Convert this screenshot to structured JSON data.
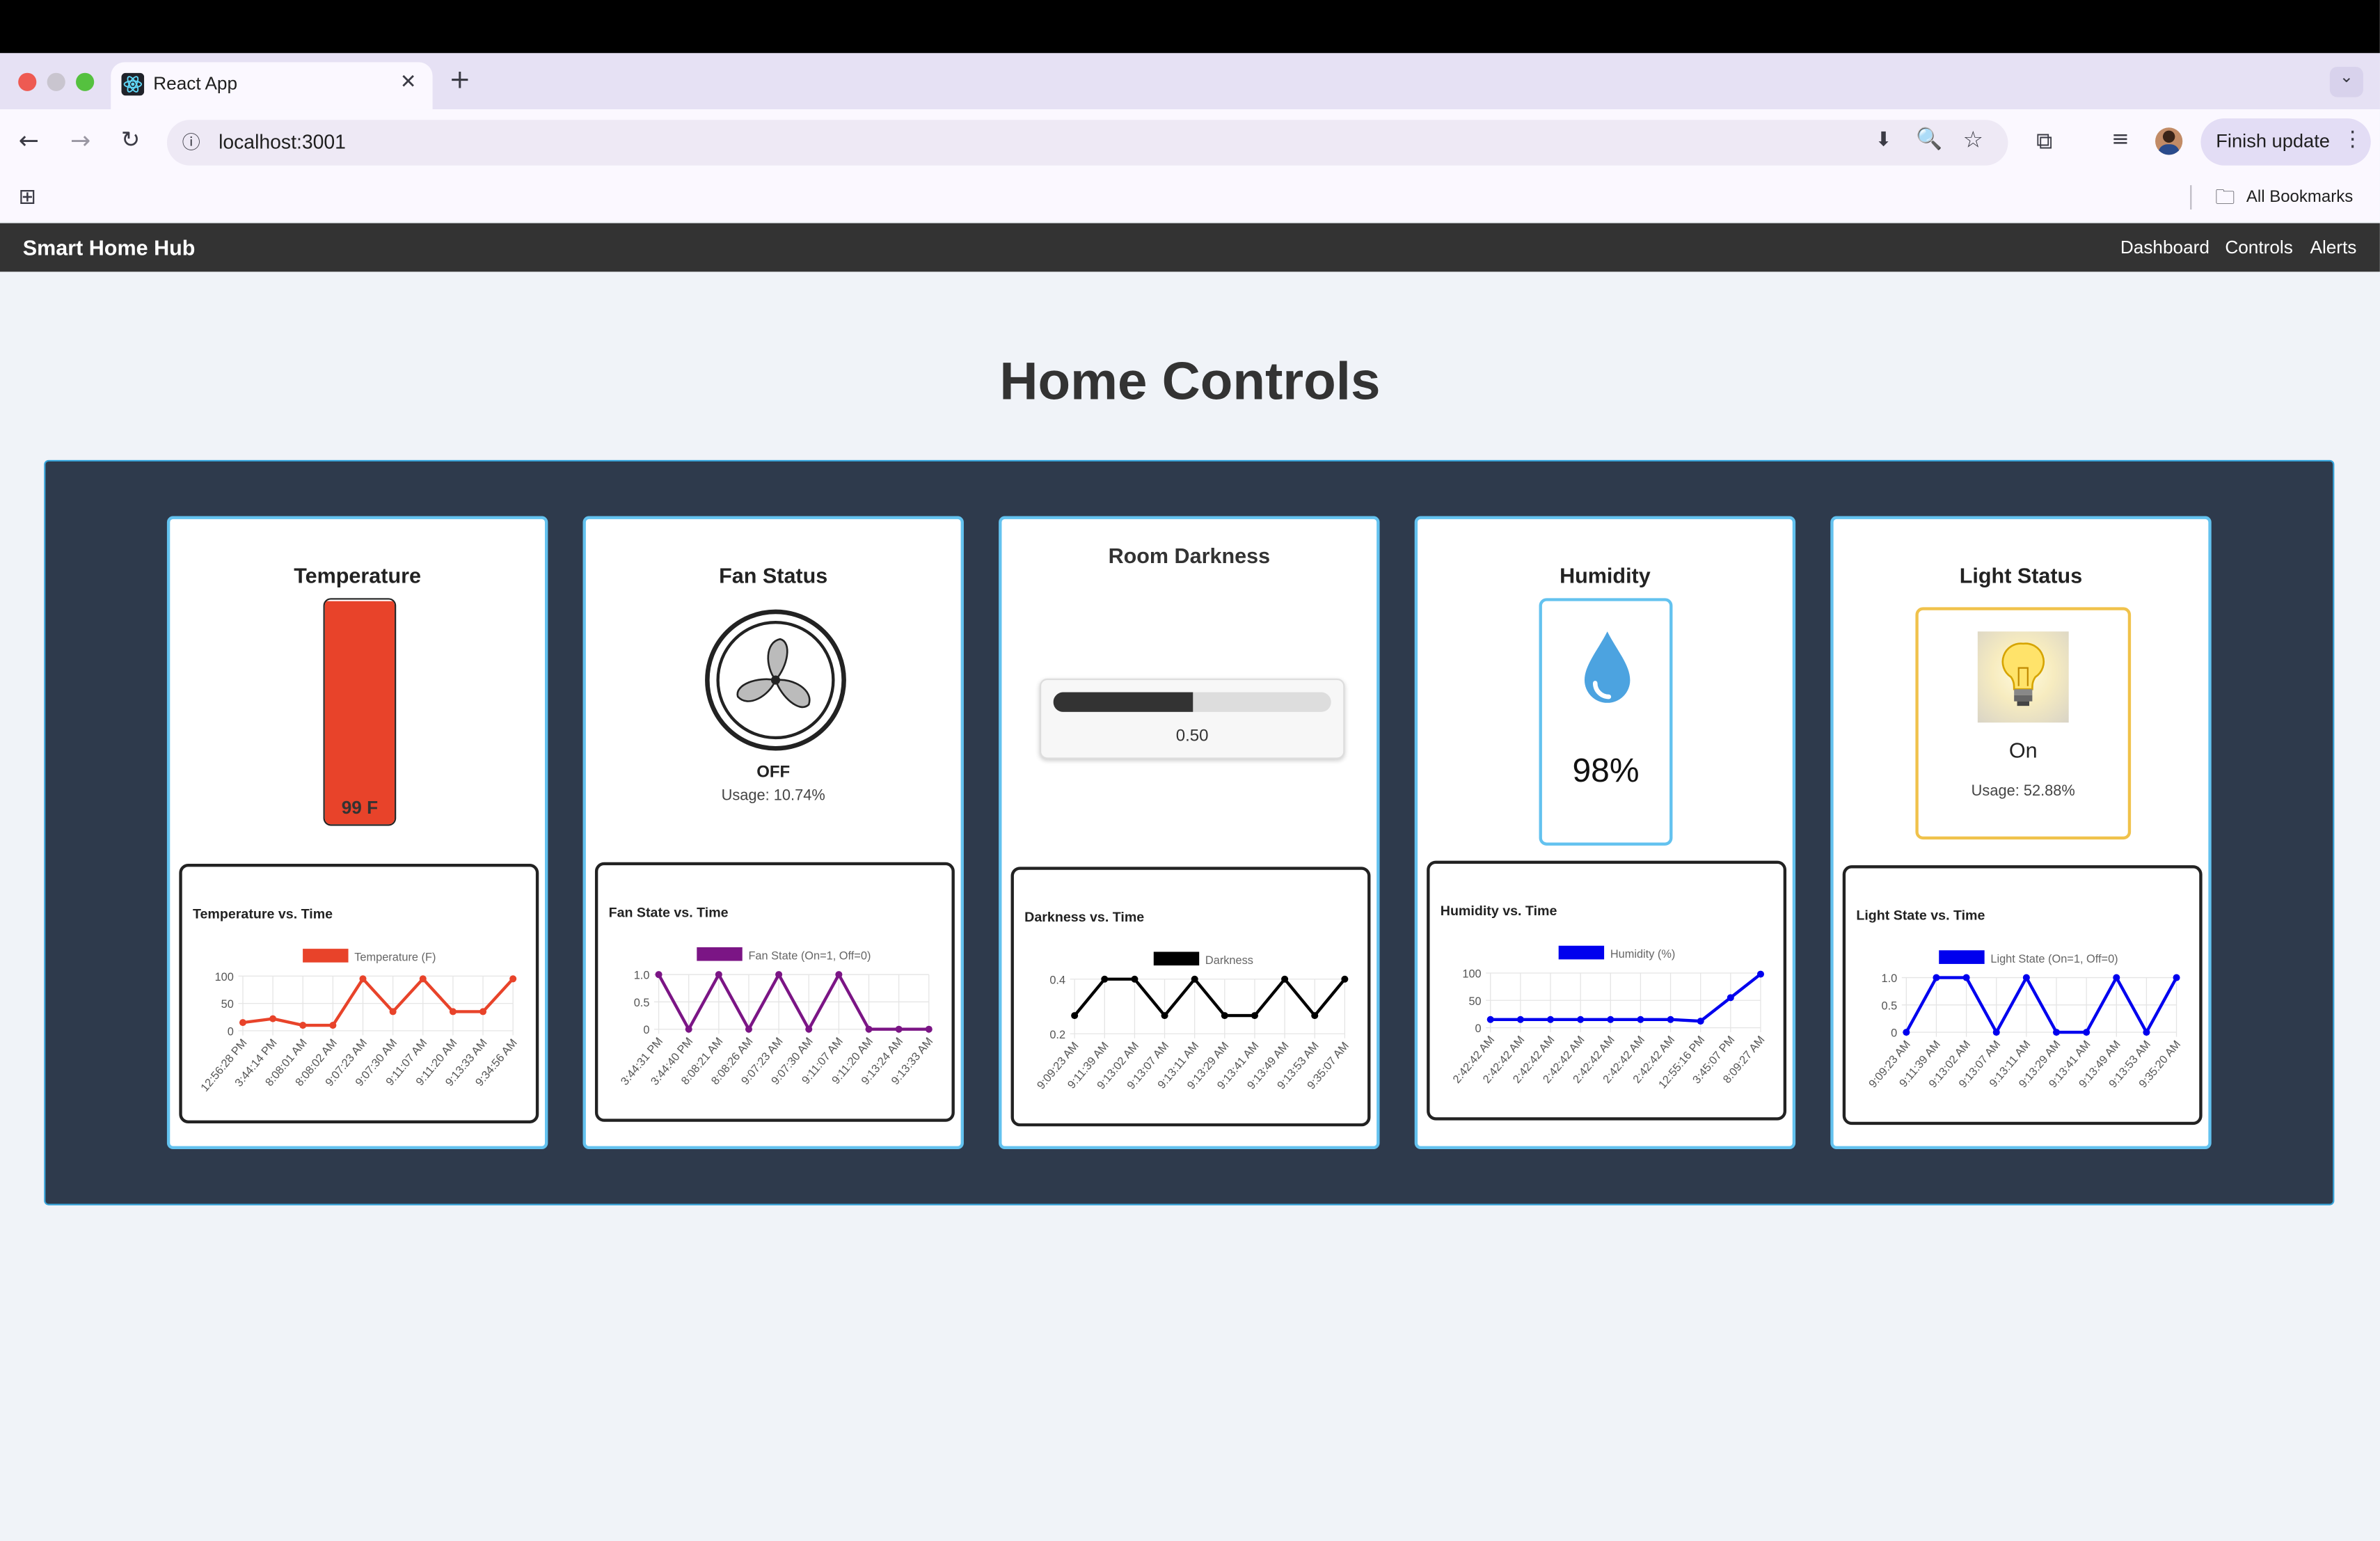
{
  "browser": {
    "tab_title": "React App",
    "url": "localhost:3001",
    "update_button": "Finish update",
    "bookmarks_label": "All Bookmarks"
  },
  "app": {
    "brand": "Smart Home Hub",
    "nav": [
      "Dashboard",
      "Controls",
      "Alerts"
    ],
    "page_title": "Home Controls"
  },
  "cards": {
    "temperature": {
      "title": "Temperature",
      "reading": "99 F",
      "level": 0.99
    },
    "fan": {
      "title": "Fan Status",
      "state": "OFF",
      "usage": "Usage: 10.74%"
    },
    "darkness": {
      "title": "Room Darkness",
      "value": "0.50",
      "fraction": 0.5
    },
    "humidity": {
      "title": "Humidity",
      "reading": "98%"
    },
    "light": {
      "title": "Light Status",
      "state": "On",
      "usage": "Usage: 52.88%"
    }
  },
  "colors": {
    "temperature": "#e8432a",
    "fan": "#7b1585",
    "darkness": "#000000",
    "humidity": "#0000ee",
    "light": "#0000ee",
    "accent_border": "#63c2ef"
  },
  "chart_data": [
    {
      "id": "temperature",
      "type": "line",
      "title": "Temperature vs. Time",
      "legend": "Temperature (F)",
      "x": [
        "12:56:28 PM",
        "3:44:14 PM",
        "8:08:01 AM",
        "8:08:02 AM",
        "9:07:23 AM",
        "9:07:30 AM",
        "9:11:07 AM",
        "9:11:20 AM",
        "9:13:33 AM",
        "9:34:56 AM"
      ],
      "y": [
        15,
        22,
        10,
        10,
        95,
        35,
        95,
        35,
        35,
        95
      ],
      "ylim": [
        0,
        100
      ],
      "yticks": [
        "100",
        "50",
        "0"
      ]
    },
    {
      "id": "fan",
      "type": "line",
      "title": "Fan State vs. Time",
      "legend": "Fan State (On=1, Off=0)",
      "x": [
        "3:44:31 PM",
        "3:44:40 PM",
        "8:08:21 AM",
        "8:08:26 AM",
        "9:07:23 AM",
        "9:07:30 AM",
        "9:11:07 AM",
        "9:11:20 AM",
        "9:13:24 AM",
        "9:13:33 AM"
      ],
      "y": [
        1,
        0,
        1,
        0,
        1,
        0,
        1,
        0,
        0,
        0
      ],
      "ylim": [
        0,
        1
      ],
      "yticks": [
        "1.0",
        "0.5",
        "0"
      ]
    },
    {
      "id": "darkness",
      "type": "line",
      "title": "Darkness vs. Time",
      "legend": "Darkness",
      "x": [
        "9:09:23 AM",
        "9:11:39 AM",
        "9:13:02 AM",
        "9:13:07 AM",
        "9:13:11 AM",
        "9:13:29 AM",
        "9:13:41 AM",
        "9:13:49 AM",
        "9:13:53 AM",
        "9:35:07 AM"
      ],
      "y": [
        0.3,
        0.5,
        0.5,
        0.3,
        0.5,
        0.3,
        0.3,
        0.5,
        0.3,
        0.5
      ],
      "ylim": [
        0.2,
        0.5
      ],
      "yticks": [
        "0.4",
        "0.2"
      ]
    },
    {
      "id": "humidity",
      "type": "line",
      "title": "Humidity vs. Time",
      "legend": "Humidity (%)",
      "x": [
        "2:42:42 AM",
        "2:42:42 AM",
        "2:42:42 AM",
        "2:42:42 AM",
        "2:42:42 AM",
        "2:42:42 AM",
        "2:42:42 AM",
        "12:55:16 PM",
        "3:45:07 PM",
        "8:09:27 AM"
      ],
      "y": [
        15,
        15,
        15,
        15,
        15,
        15,
        15,
        12,
        55,
        98
      ],
      "ylim": [
        0,
        100
      ],
      "yticks": [
        "100",
        "50",
        "0"
      ]
    },
    {
      "id": "light",
      "type": "line",
      "title": "Light State vs. Time",
      "legend": "Light State (On=1, Off=0)",
      "x": [
        "9:09:23 AM",
        "9:11:39 AM",
        "9:13:02 AM",
        "9:13:07 AM",
        "9:13:11 AM",
        "9:13:29 AM",
        "9:13:41 AM",
        "9:13:49 AM",
        "9:13:53 AM",
        "9:35:20 AM"
      ],
      "y": [
        0,
        1,
        1,
        0,
        1,
        0,
        0,
        1,
        0,
        1
      ],
      "ylim": [
        0,
        1
      ],
      "yticks": [
        "1.0",
        "0.5",
        "0"
      ]
    }
  ]
}
